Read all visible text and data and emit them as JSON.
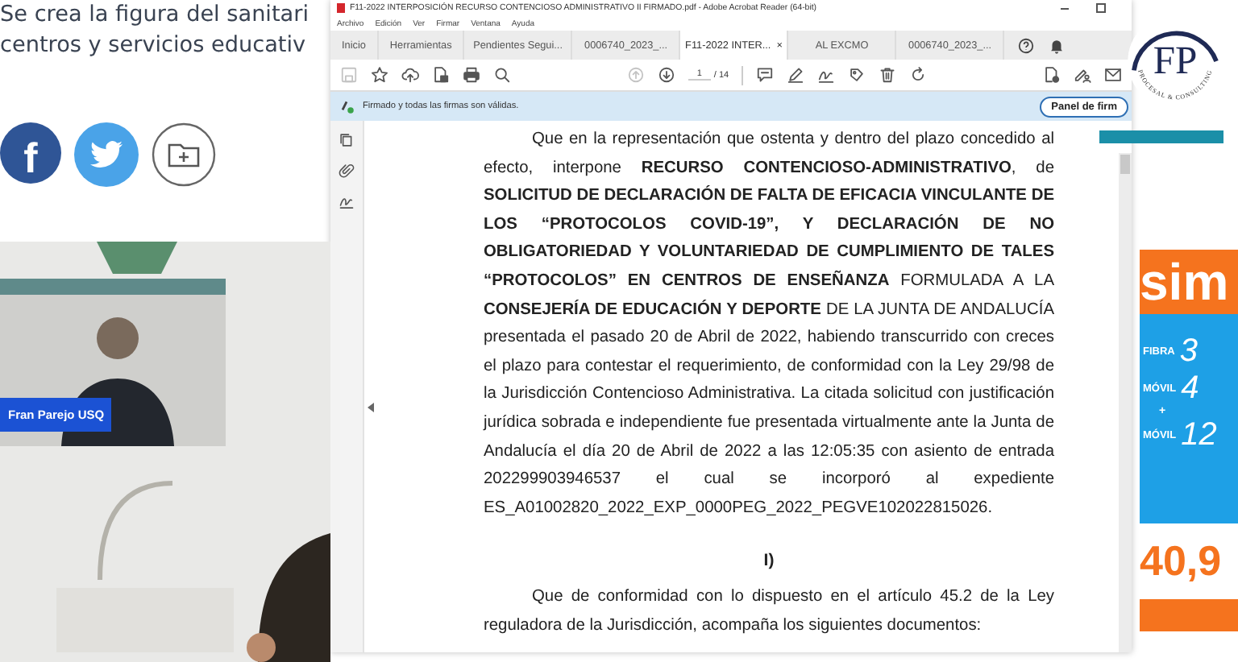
{
  "news": {
    "headline_lines": [
      "Se crea la figura del sanitari",
      "centros y servicios educativ"
    ],
    "share_buttons": [
      {
        "kind": "facebook",
        "glyph": "f"
      },
      {
        "kind": "twitter"
      },
      {
        "kind": "save"
      }
    ]
  },
  "video": {
    "kind": "picture",
    "caption": "Fran Parejo USQ"
  },
  "acrobat": {
    "title": "F11-2022 INTERPOSICIÓN RECURSO CONTENCIOSO ADMINISTRATIVO II FIRMADO.pdf - Adobe Acrobat Reader (64-bit)",
    "menu": [
      "Archivo",
      "Edición",
      "Ver",
      "Firmar",
      "Ventana",
      "Ayuda"
    ],
    "tabs": [
      {
        "label": "Inicio",
        "selected": false,
        "kind": "nav"
      },
      {
        "label": "Herramientas",
        "selected": false,
        "kind": "nav"
      },
      {
        "label": "Pendientes Segui...",
        "selected": false,
        "kind": "doc"
      },
      {
        "label": "0006740_2023_...",
        "selected": false,
        "kind": "doc"
      },
      {
        "label": "F11-2022 INTER...",
        "selected": true,
        "kind": "doc",
        "close": "×"
      },
      {
        "label": "AL EXCMO",
        "selected": false,
        "kind": "doc"
      },
      {
        "label": "0006740_2023_...",
        "selected": false,
        "kind": "doc"
      }
    ],
    "toolbar_left": [
      {
        "kind": "save",
        "disabled": true
      },
      {
        "kind": "star",
        "disabled": false
      },
      {
        "kind": "upload",
        "disabled": false
      },
      {
        "kind": "file",
        "disabled": false
      },
      {
        "kind": "print",
        "disabled": false
      },
      {
        "kind": "search",
        "disabled": false
      }
    ],
    "nav": [
      {
        "kind": "up",
        "disabled": true
      },
      {
        "kind": "down",
        "disabled": false
      }
    ],
    "page": {
      "value": "1",
      "total": "/ 14"
    },
    "toolbar_tools": [
      {
        "kind": "comment",
        "disabled": false
      },
      {
        "kind": "pen",
        "disabled": false
      },
      {
        "kind": "sign",
        "disabled": false
      },
      {
        "kind": "stamp",
        "disabled": false
      },
      {
        "kind": "trash",
        "disabled": false
      },
      {
        "kind": "rotate",
        "disabled": false
      }
    ],
    "toolbar_right": [
      {
        "kind": "fileedit",
        "disabled": false
      },
      {
        "kind": "signer",
        "disabled": false
      },
      {
        "kind": "mail",
        "disabled": false
      }
    ],
    "signature_bar": {
      "message": "Firmado y todas las firmas son válidas.",
      "button": "Panel de firm"
    },
    "rail": [
      {
        "kind": "copy"
      },
      {
        "kind": "clip"
      },
      {
        "kind": "sign"
      }
    ],
    "document": [
      {
        "kind": "paragraph",
        "text": "Que en la representación que ostenta y dentro del plazo concedido al efecto, interpone **RECURSO CONTENCIOSO-ADMINISTRATIVO**, de **SOLICITUD DE DECLARACIÓN DE FALTA DE EFICACIA VINCULANTE DE LOS “PROTOCOLOS COVID-19”, Y DECLARACIÓN DE NO OBLIGATORIEDAD Y VOLUNTARIEDAD DE CUMPLIMIENTO DE TALES “PROTOCOLOS” EN CENTROS DE ENSEÑANZA** FORMULADA A LA **CONSEJERÍA DE EDUCACIÓN Y DEPORTE** DE LA JUNTA DE ANDALUCÍA presentada el pasado 20 de Abril de 2022, habiendo transcurrido con creces el plazo para contestar el requerimiento, de conformidad con la Ley 29/98 de la Jurisdicción Contencioso Administrativa. La citada solicitud con justificación jurídica sobrada e independiente fue presentada virtualmente ante la Junta de Andalucía el día 20 de Abril de 2022 a las 12:05:35 con asiento de entrada 202299903946537 el cual se incorporó al expediente ES_A01002820_2022_EXP_0000PEG_2022_PEGVE102022815026."
      },
      {
        "kind": "heading",
        "text": "I)"
      },
      {
        "kind": "paragraph",
        "text": "Que de conformidad con lo dispuesto en el artículo 45.2 de la Ley reguladora de la Jurisdicción, acompaña los siguientes documentos:"
      }
    ]
  },
  "logo": {
    "letters": "FP",
    "tagline": "PROCESAL & CONSULTING"
  },
  "ad": {
    "brand": "sim",
    "rows": [
      {
        "kind": "offer",
        "label": "FIBRA",
        "value": "3"
      },
      {
        "kind": "offer",
        "label": "MÓVIL",
        "value": "4"
      },
      {
        "kind": "plus",
        "label": "+"
      },
      {
        "kind": "offer",
        "label": "MÓVIL",
        "value": "12"
      }
    ],
    "price": "40,9"
  }
}
